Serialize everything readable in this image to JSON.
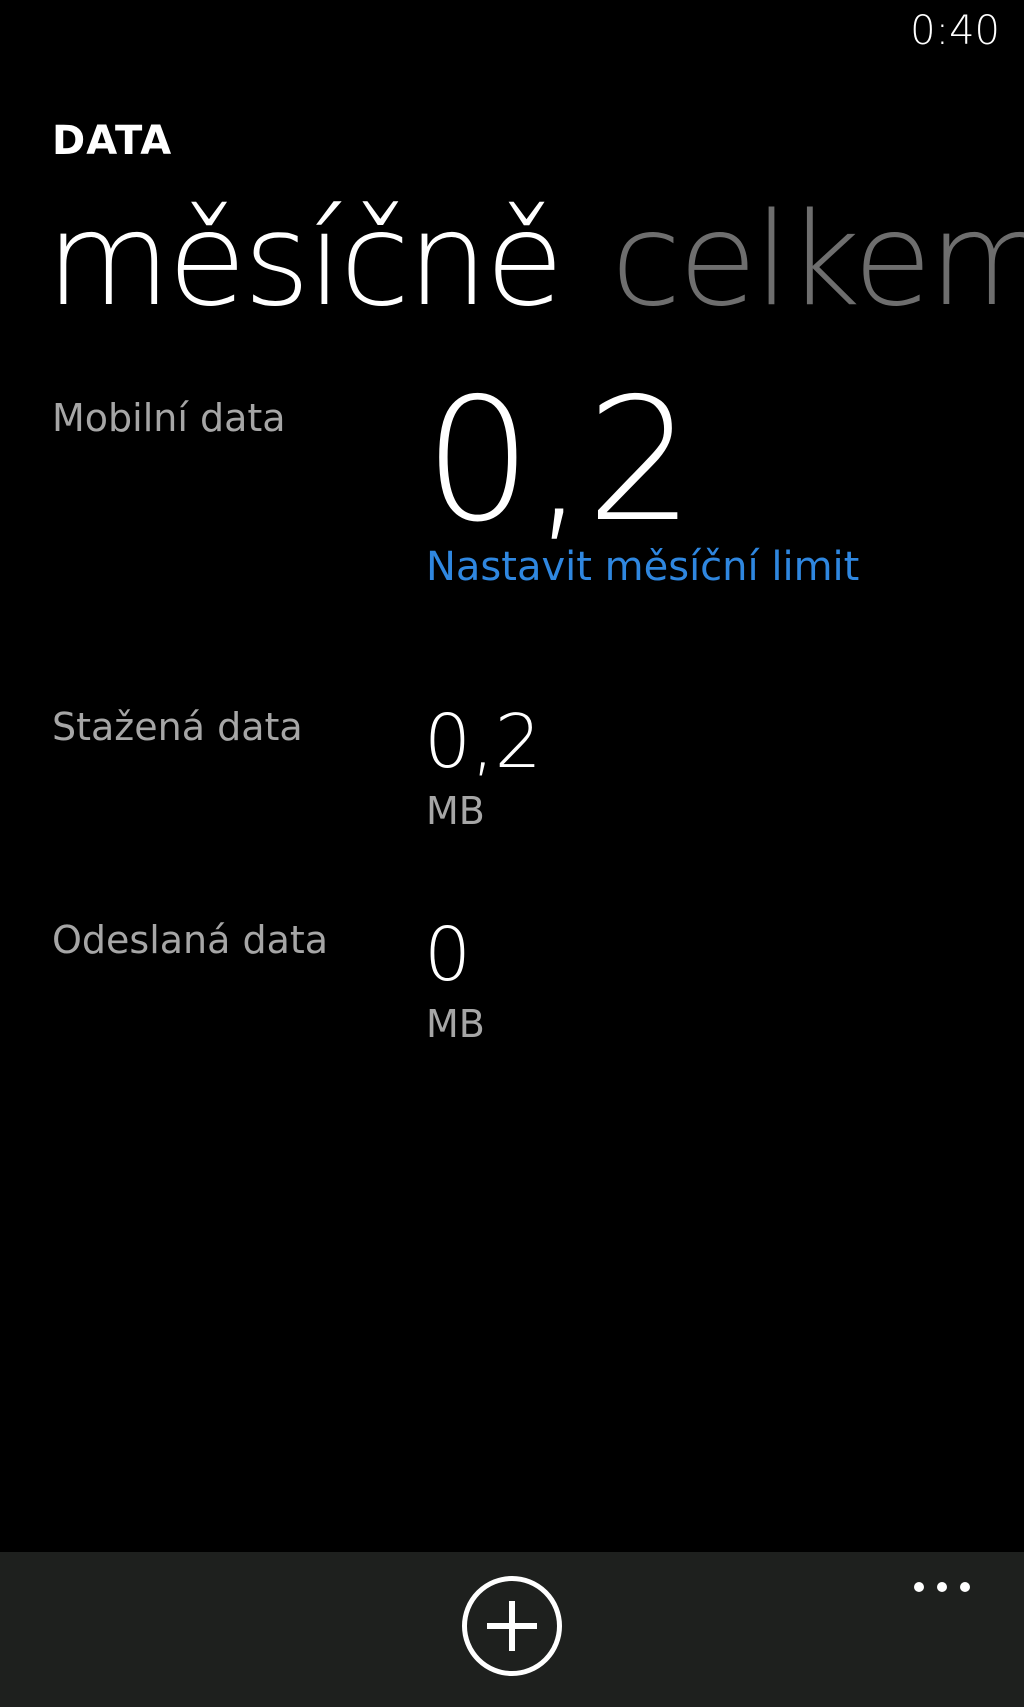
{
  "status_bar": {
    "time": "0:40"
  },
  "app": {
    "title": "DATA"
  },
  "pivot": {
    "items": [
      {
        "label": "měsíčně"
      },
      {
        "label": "celkem"
      }
    ]
  },
  "stats": {
    "mobile": {
      "label": "Mobilní data",
      "value": "0,2",
      "link": "Nastavit měsíční limit"
    },
    "downloaded": {
      "label": "Stažená data",
      "value": "0,2",
      "unit": "MB"
    },
    "uploaded": {
      "label": "Odeslaná data",
      "value": "0",
      "unit": "MB"
    }
  },
  "app_bar": {
    "add_icon": "add-circle-icon",
    "more_icon": "ellipsis-icon"
  },
  "colors": {
    "background": "#000000",
    "accent": "#2f87e0",
    "app_bar": "#1e201e",
    "inactive_pivot": "#6e6e6e"
  }
}
